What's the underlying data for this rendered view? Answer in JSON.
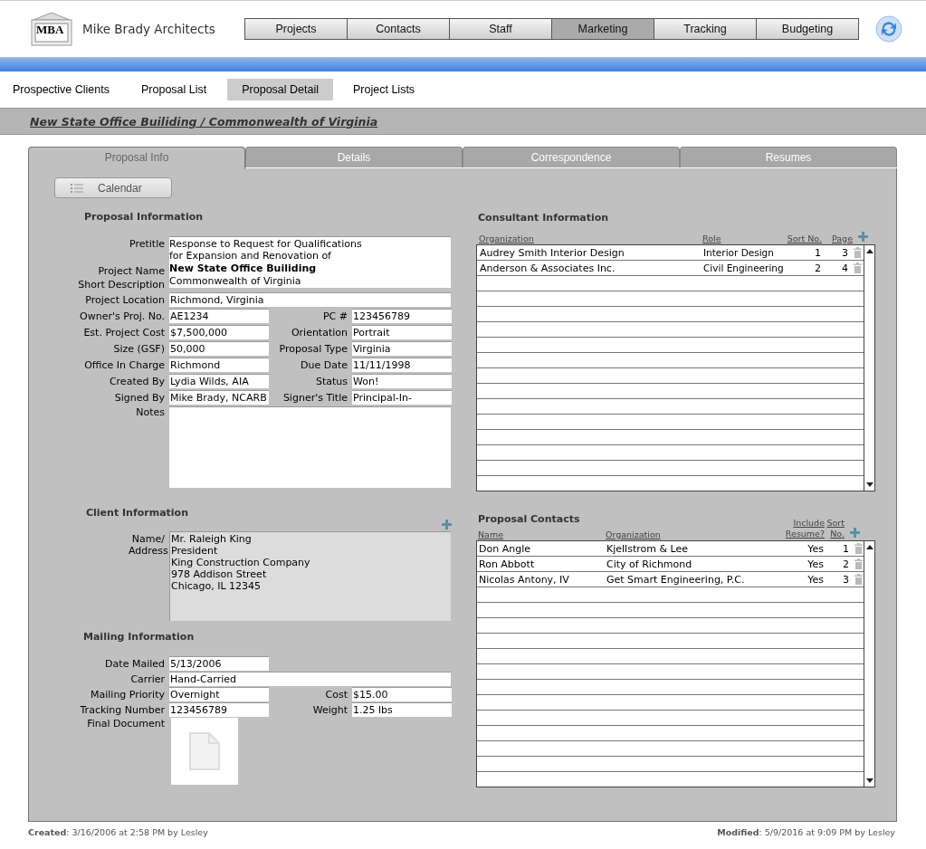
{
  "app": {
    "logo_text": "MBA",
    "name": "Mike Brady Architects"
  },
  "main_nav": [
    {
      "label": "Projects",
      "selected": false
    },
    {
      "label": "Contacts",
      "selected": false
    },
    {
      "label": "Staff",
      "selected": false
    },
    {
      "label": "Marketing",
      "selected": true
    },
    {
      "label": "Tracking",
      "selected": false
    },
    {
      "label": "Budgeting",
      "selected": false
    }
  ],
  "sub_nav": [
    {
      "label": "Prospective Clients",
      "selected": false
    },
    {
      "label": "Proposal List",
      "selected": false
    },
    {
      "label": "Proposal Detail",
      "selected": true
    },
    {
      "label": "Project Lists",
      "selected": false
    }
  ],
  "record_title": "New State Office Builiding / Commonwealth of Virginia",
  "tabs": [
    {
      "label": "Proposal Info",
      "selected": true
    },
    {
      "label": "Details",
      "selected": false
    },
    {
      "label": "Correspondence",
      "selected": false
    },
    {
      "label": "Resumes",
      "selected": false
    }
  ],
  "calendar_button": "Calendar",
  "proposal_information": {
    "heading": "Proposal Information",
    "pretitle": {
      "label": "Pretitle",
      "lines": [
        "Response to Request for Qualifications",
        "for Expansion and Renovation of"
      ]
    },
    "project_name": {
      "label": "Project Name",
      "value": "New State Office Builiding"
    },
    "short_description": {
      "label": "Short Description",
      "value": "Commonwealth of Virginia"
    },
    "project_location": {
      "label": "Project Location",
      "value": "Richmond, Virginia"
    },
    "rows": [
      {
        "left": {
          "label": "Owner's Proj. No.",
          "value": "AE1234"
        },
        "right": {
          "label": "PC #",
          "value": "123456789"
        }
      },
      {
        "left": {
          "label": "Est. Project Cost",
          "value": "$7,500,000"
        },
        "right": {
          "label": "Orientation",
          "value": "Portrait"
        }
      },
      {
        "left": {
          "label": "Size (GSF)",
          "value": "50,000"
        },
        "right": {
          "label": "Proposal Type",
          "value": "Virginia"
        }
      },
      {
        "left": {
          "label": "Office In Charge",
          "value": "Richmond"
        },
        "right": {
          "label": "Due Date",
          "value": "11/11/1998"
        }
      },
      {
        "left": {
          "label": "Created By",
          "value": "Lydia Wilds, AIA"
        },
        "right": {
          "label": "Status",
          "value": "Won!"
        }
      },
      {
        "left": {
          "label": "Signed By",
          "value": "Mike Brady, NCARB"
        },
        "right": {
          "label": "Signer's Title",
          "value": "Principal-In-"
        }
      }
    ],
    "notes": {
      "label": "Notes"
    }
  },
  "client_information": {
    "heading": "Client Information",
    "label": "Name/ Address",
    "lines": [
      "Mr. Raleigh King",
      "President",
      "King Construction Company",
      "978 Addison Street",
      "Chicago, IL 12345"
    ]
  },
  "mailing_information": {
    "heading": "Mailing Information",
    "date_mailed": {
      "label": "Date Mailed",
      "value": "5/13/2006"
    },
    "carrier": {
      "label": "Carrier",
      "value": "Hand-Carried"
    },
    "rows": [
      {
        "left": {
          "label": "Mailing Priority",
          "value": "Overnight"
        },
        "right": {
          "label": "Cost",
          "value": "$15.00"
        }
      },
      {
        "left": {
          "label": "Tracking Number",
          "value": "123456789"
        },
        "right": {
          "label": "Weight",
          "value": "1.25 lbs"
        }
      }
    ],
    "final_document": {
      "label": "Final Document"
    }
  },
  "consultant_information": {
    "heading": "Consultant Information",
    "columns": [
      "Organization",
      "Role",
      "Sort No.",
      "Page"
    ],
    "rows": [
      {
        "organization": "Audrey Smith Interior Design",
        "role": "Interior Design",
        "sort_no": "1",
        "page": "3"
      },
      {
        "organization": "Anderson & Associates Inc.",
        "role": "Civil Engineering",
        "sort_no": "2",
        "page": "4"
      }
    ]
  },
  "proposal_contacts": {
    "heading": "Proposal Contacts",
    "columns": [
      "Name",
      "Organization",
      "Include Resume?",
      "Sort No."
    ],
    "rows": [
      {
        "name": "Don Angle",
        "organization": "Kjellstrom & Lee",
        "include_resume": "Yes",
        "sort_no": "1"
      },
      {
        "name": "Ron Abbott",
        "organization": "City of Richmond",
        "include_resume": "Yes",
        "sort_no": "2"
      },
      {
        "name": "Nicolas Antony, IV",
        "organization": "Get Smart Engineering, P.C.",
        "include_resume": "Yes",
        "sort_no": "3"
      }
    ]
  },
  "footer": {
    "created": "**Created**: 3/16/2006 at 2:58 PM by Lesley",
    "modified": "**Modified**: 5/9/2016 at 9:09 PM by Lesley"
  }
}
